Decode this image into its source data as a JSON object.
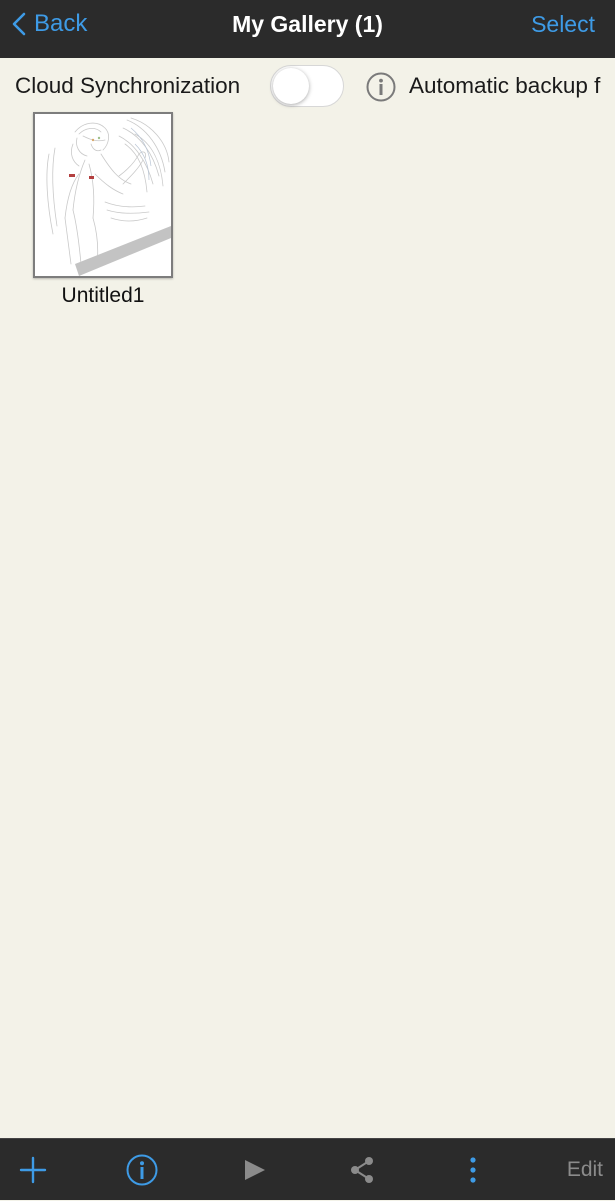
{
  "header": {
    "back_label": "Back",
    "title": "My Gallery (1)",
    "select_label": "Select"
  },
  "sync": {
    "label": "Cloud Synchronization",
    "enabled": false,
    "description": "Automatic backup f"
  },
  "gallery": {
    "items": [
      {
        "title": "Untitled1"
      }
    ]
  },
  "toolbar": {
    "edit_label": "Edit",
    "icons": [
      "add-icon",
      "info-icon",
      "play-icon",
      "share-icon",
      "more-vertical-icon"
    ]
  },
  "colors": {
    "accent": "#3e9be6",
    "bar_background": "#2b2b2b",
    "page_background": "#f3f2e8",
    "disabled_text": "#8b8b8b"
  }
}
